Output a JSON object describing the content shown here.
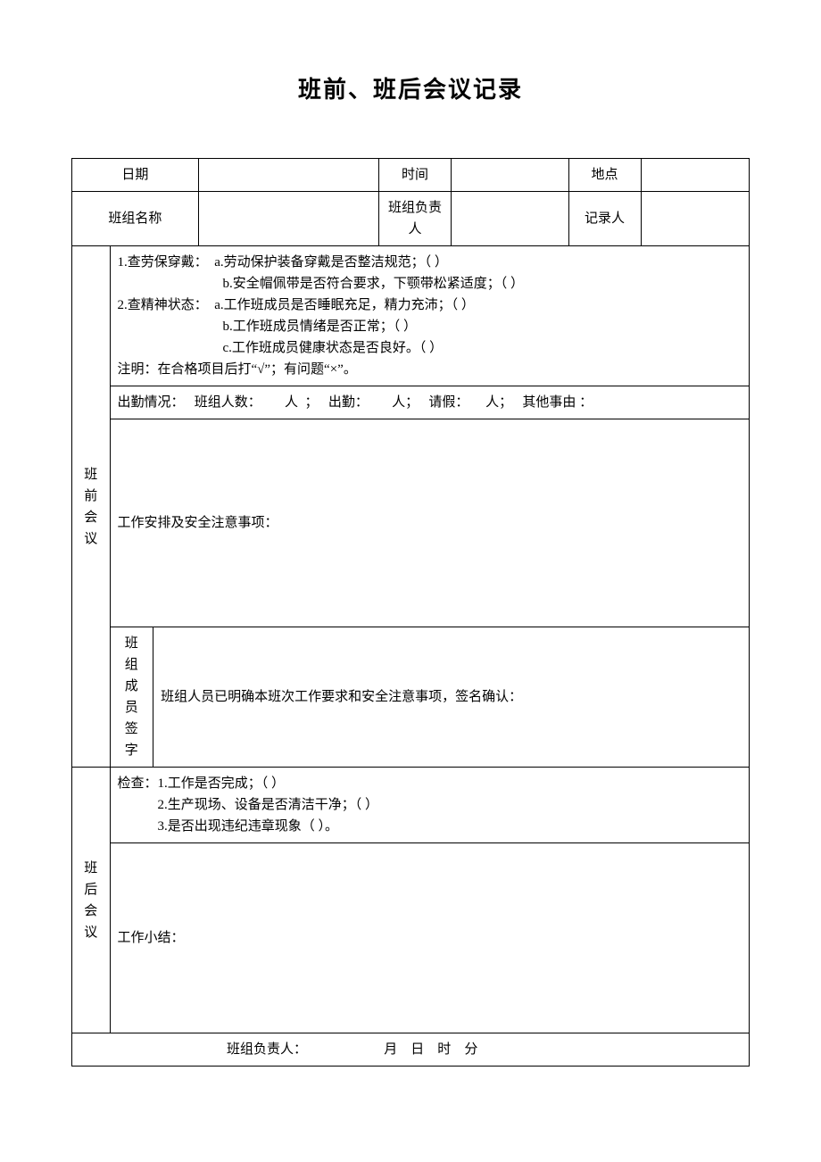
{
  "title": "班前、班后会议记录",
  "header": {
    "date_label": "日期",
    "time_label": "时间",
    "location_label": "地点",
    "team_name_label": "班组名称",
    "team_leader_label": "班组负责人",
    "recorder_label": "记录人",
    "date_value": "",
    "time_value": "",
    "location_value": "",
    "team_name_value": "",
    "team_leader_value": "",
    "recorder_value": ""
  },
  "pre_meeting": {
    "section_label": "班前会议",
    "checklist": {
      "item1_label": "1.查劳保穿戴：",
      "item1_a": "a.劳动保护装备穿戴是否整洁规范；（  ）",
      "item1_b": "b.安全帽佩带是否符合要求，下颚带松紧适度；（  ）",
      "item2_label": "2.查精神状态：",
      "item2_a": "a.工作班成员是否睡眠充足，精力充沛；（  ）",
      "item2_b": "b.工作班成员情绪是否正常；（  ）",
      "item2_c": "c.工作班成员健康状态是否良好。（  ）",
      "note": "注明：在合格项目后打“√”；有问题“×”。"
    },
    "attendance": {
      "label": "出勤情况：",
      "team_count_label": "班组人数：",
      "unit_person": "人",
      "sep": "；",
      "attend_label": "出勤：",
      "leave_label": "请假：",
      "other_label": "其他事由 ："
    },
    "work_arrangement_label": "工作安排及安全注意事项：",
    "member_sign_label": "班组成员签字",
    "member_sign_text": "班组人员已明确本班次工作要求和安全注意事项，签名确认："
  },
  "post_meeting": {
    "section_label": "班后会议",
    "check_label": "检查：",
    "check1": "1.工作是否完成；（   ）",
    "check2": "2.生产现场、设备是否清洁干净；（   ）",
    "check3": "3.是否出现违纪违章现象（   ）。",
    "summary_label": "工作小结："
  },
  "footer": {
    "leader_label": "班组负责人：",
    "month": "月",
    "day": "日",
    "hour": "时",
    "minute": "分"
  }
}
